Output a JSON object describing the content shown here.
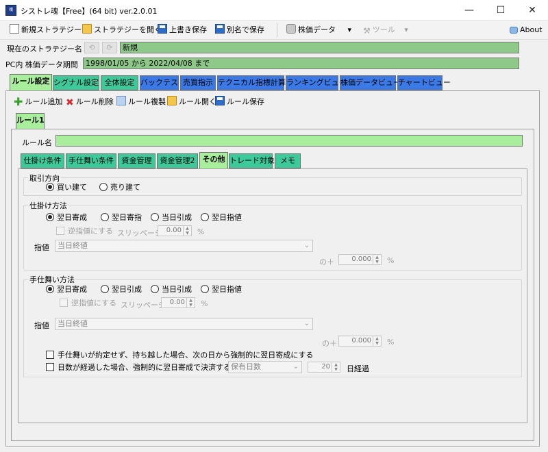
{
  "window": {
    "title": "シストレ魂【Free】(64 bit) ver.2.0.01",
    "icon_text": "魂",
    "minimize": "—",
    "maximize": "☐",
    "close": "✕"
  },
  "toolbar": {
    "new_strategy": "新規ストラテジー",
    "open_strategy": "ストラテジーを開く",
    "overwrite_save": "上書き保存",
    "save_as": "別名で保存",
    "stock_data": "株価データ",
    "stock_data_arrow": "▾",
    "tools": "ツール",
    "tools_arrow": "▾",
    "about": "About"
  },
  "strategy": {
    "label": "現在のストラテジー名",
    "value": "新規",
    "undo": "⟲",
    "redo": "⟳"
  },
  "period": {
    "label": "PC内 株価データ期間",
    "value": "1998/01/05 から 2022/04/08 まで"
  },
  "main_tabs": [
    {
      "label": "ルール設定"
    },
    {
      "label": "シグナル設定"
    },
    {
      "label": "全体設定"
    },
    {
      "label": "バックテスト"
    },
    {
      "label": "売買指示"
    },
    {
      "label": "テクニカル指標計算"
    },
    {
      "label": "ランキングビュー"
    },
    {
      "label": "株価データビュー"
    },
    {
      "label": "チャートビュー"
    }
  ],
  "rule_toolbar": {
    "add": "ルール追加",
    "delete": "ルール削除",
    "copy": "ルール複製",
    "open": "ルール開く",
    "save": "ルール保存"
  },
  "rule_tab": "ルール1",
  "rule_name": {
    "label": "ルール名",
    "value": ""
  },
  "sub_tabs": [
    {
      "label": "仕掛け条件"
    },
    {
      "label": "手仕舞い条件"
    },
    {
      "label": "資金管理"
    },
    {
      "label": "資金管理2"
    },
    {
      "label": "その他"
    },
    {
      "label": "トレード対象"
    },
    {
      "label": "メモ"
    }
  ],
  "direction": {
    "title": "取引方向",
    "options": [
      "買い建て",
      "売り建て"
    ]
  },
  "entry": {
    "title": "仕掛け方法",
    "options": [
      "翌日寄成",
      "翌日寄指",
      "当日引成",
      "翌日指値"
    ],
    "reverse_limit": "逆指値にする",
    "slippage_label": "スリッページ",
    "slippage_value": "0.00",
    "slippage_unit": "%",
    "limit_label": "指値",
    "limit_value": "当日終値",
    "of_label": "の＋",
    "of_value": "0.000",
    "of_unit": "%"
  },
  "exit": {
    "title": "手仕舞い方法",
    "options": [
      "翌日寄成",
      "翌日引成",
      "当日引成",
      "翌日指値"
    ],
    "reverse_limit": "逆指値にする",
    "slippage_label": "スリッページ",
    "slippage_value": "0.00",
    "slippage_unit": "%",
    "limit_label": "指値",
    "limit_value": "当日終値",
    "of_label": "の＋",
    "of_value": "0.000",
    "of_unit": "%"
  },
  "options": {
    "force_next_open": "手仕舞いが約定せず、持ち越した場合、次の日から強制的に翌日寄成にする",
    "force_after_days": "日数が経過した場合、強制的に翌日寄成で決済する",
    "days_type": "保有日数",
    "days_value": "20",
    "days_unit": "日経過"
  }
}
